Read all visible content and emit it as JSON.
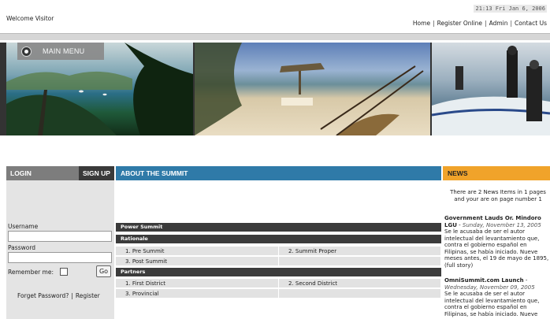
{
  "header": {
    "welcome": "Welcome Visitor",
    "clock": "21:13  Fri  Jan 6, 2006",
    "links": [
      "Home",
      "Register Online",
      "Admin",
      "Contact Us"
    ]
  },
  "banner": {
    "menu_label": "MAIN MENU"
  },
  "columns": {
    "login": "LOGIN",
    "signup": "SIGN UP",
    "about": "ABOUT THE SUMMIT",
    "news": "NEWS"
  },
  "login_form": {
    "username_label": "Username",
    "password_label": "Password",
    "remember_label": "Remember me:",
    "go_label": "Go",
    "forgot_label": "Forget Password?",
    "register_label": "Register"
  },
  "summit": {
    "power_summit": "Power Summit",
    "rationale": {
      "title": "Rationale",
      "items": [
        "1. Pre Summit",
        "2. Summit Proper",
        "3. Post Summit"
      ]
    },
    "partners": {
      "title": "Partners",
      "items": [
        "1. First District",
        "2. Second District",
        "3. Provincial"
      ]
    }
  },
  "news": {
    "summary": "There are 2 News Items in 1 pages and your are on page number 1",
    "items": [
      {
        "title": "Government Lauds Or. Mindoro LGU",
        "date": "Sunday, November 13, 2005",
        "body": "Se le acusaba de ser el autor intelectual del levantamiento que, contra el gobierno español en Filipinas, se había iniciado. Nueve meses antes, el 19 de mayo de 1895, (full story)"
      },
      {
        "title": "OmniSummit.com Launch",
        "date": "Wednesday, November 09, 2005",
        "body": "Se le acusaba de ser el autor intelectual del levantamiento que, contra el gobierno español en Filipinas, se había iniciado. Nueve"
      }
    ]
  }
}
